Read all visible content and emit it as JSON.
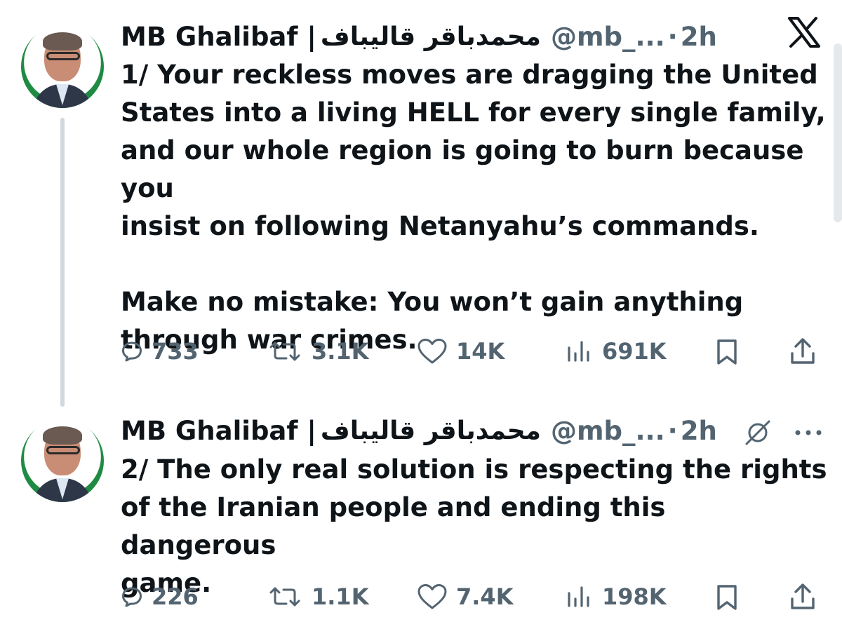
{
  "tweets": [
    {
      "name": "MB Ghalibaf |",
      "arabic_name": "محمدباقر قالیباف",
      "handle": "@mb_...",
      "separator": "·",
      "time": "2h",
      "text": "1/ Your reckless moves are dragging the United\nStates into a living HELL for every single family,\nand our whole region is going to burn because you\ninsist on following Netanyahu’s commands.\n\nMake no mistake: You won’t gain anything\nthrough war crimes.",
      "replies": "733",
      "reposts": "3.1K",
      "likes": "14K",
      "views": "691K"
    },
    {
      "name": "MB Ghalibaf |",
      "arabic_name": "محمدباقر قالیباف",
      "handle": "@mb_...",
      "separator": "·",
      "time": "2h",
      "text": "2/ The only real solution is respecting the rights\nof the Iranian people and ending this dangerous\ngame.",
      "replies": "226",
      "reposts": "1.1K",
      "likes": "7.4K",
      "views": "198K"
    }
  ],
  "icons": {
    "brand": "x-logo-icon",
    "reply": "reply-icon",
    "repost": "repost-icon",
    "like": "heart-icon",
    "views": "views-icon",
    "bookmark": "bookmark-icon",
    "share": "share-icon",
    "grok": "grok-icon",
    "more": "more-icon"
  },
  "colors": {
    "text": "#0f1419",
    "secondary": "#536471",
    "thread_line": "#cfd9de"
  }
}
